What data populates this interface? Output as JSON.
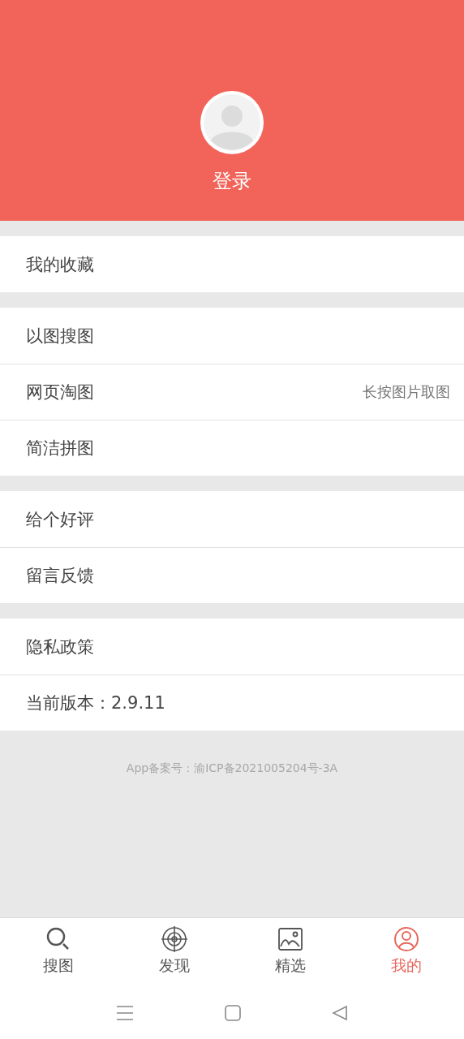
{
  "header": {
    "login": "登录"
  },
  "menu_groups": [
    {
      "items": [
        {
          "label": "我的收藏"
        }
      ]
    },
    {
      "items": [
        {
          "label": "以图搜图"
        },
        {
          "label": "网页淘图",
          "hint": "长按图片取图"
        },
        {
          "label": "简洁拼图"
        }
      ]
    },
    {
      "items": [
        {
          "label": "给个好评"
        },
        {
          "label": "留言反馈"
        }
      ]
    },
    {
      "items": [
        {
          "label": "隐私政策"
        },
        {
          "label": "当前版本：2.9.11"
        }
      ]
    }
  ],
  "footer_note": "App备案号：渝ICP备2021005204号-3A",
  "tabs": [
    {
      "label": "搜图",
      "kind": "search",
      "selected": false
    },
    {
      "label": "发现",
      "kind": "target",
      "selected": false
    },
    {
      "label": "精选",
      "kind": "image",
      "selected": false
    },
    {
      "label": "我的",
      "kind": "user",
      "selected": true
    }
  ]
}
